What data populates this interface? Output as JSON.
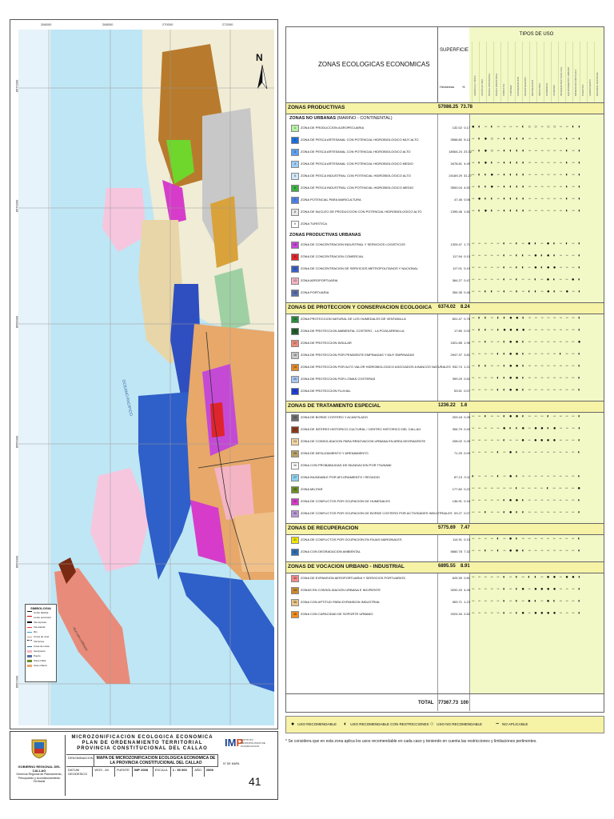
{
  "map": {
    "coords_top": [
      "266000",
      "268000",
      "270000",
      "272000"
    ],
    "coords_left": [
      "8672000",
      "8670000",
      "8668000",
      "8666000",
      "8664000",
      "8662000"
    ],
    "north_label": "N",
    "ocean_label": "OCEANO PACIFICO",
    "island_label": "ISLA SAN LORENZO",
    "legend": {
      "title": "SIMBOLOGIA",
      "items": [
        "Limite distrital",
        "Limite provincial",
        "Via expresa",
        "Via arterial",
        "Rio",
        "Curva de nivel",
        "Via ferrea",
        "Linea de costa",
        "Aeropuerto",
        "Puerto",
        "Zona militar",
        "Area urbana"
      ]
    }
  },
  "title_block": {
    "gov_logo_text": "GOBIERNO REGIONAL DEL CALLAO",
    "gov_sub": "Gerencia Regional de Planeamiento, Presupuesto y Acondicionamiento Territorial",
    "header_lines": [
      "MICROZONIFICACION ECOLOGICA ECONOMICA",
      "PLAN DE ORDENAMIENTO TERRITORIAL",
      "PROVINCIA CONSTITUCIONAL DEL CALLAO"
    ],
    "map_label": "DENOMINACION",
    "map_title": "MAPA DE MICROZONIFICACION ECOLOGICA ECONOMICA DE LA PROVINCIA CONSTITUCIONAL DEL CALLAO",
    "map_no_label": "N° DE MAPA",
    "map_no": "41",
    "row2": [
      "DATUM GEODESICO",
      "WGS - 84",
      "FUENTE",
      "IMP 2008",
      "ESCALA",
      "1 : 50 000",
      "AÑO",
      "2008"
    ],
    "imp_logo": "IMP",
    "imp_sub": "INSTITUTO METROPOLITANO DE PLANIFICACION"
  },
  "table": {
    "title": "ZONAS ECOLOGICAS ECONOMICAS",
    "superficie": "SUPERFICIE",
    "hectareas": "Hectareas",
    "percent": "%",
    "tipos_de_uso": "TIPOS DE USO",
    "use_columns": [
      "AGRICOLA TIPICA",
      "ACUICULTURA",
      "PESCA ARTESANAL",
      "PESCA INDUSTRIAL",
      "FORESTAL",
      "TURISMO",
      "CONSERVACION",
      "INVESTIGACION",
      "RECREACION",
      "INDUSTRIA",
      "COMERCIO",
      "VIVIENDA",
      "INFRAESTRUCTURA VIAL",
      "EQUIPAMIENTO URBANO",
      "MINERIA NO METALICA",
      "PUERTOS",
      "AEROPUERTO",
      "DEFENSA NACIONAL"
    ],
    "sections": [
      {
        "label": "ZONAS PRODUCTIVAS",
        "ha": "57086.25",
        "pct": "73.78",
        "subsections": [
          {
            "label": "ZONAS NO URBANAS",
            "sub": "(MARINO - CONTINENTAL)",
            "rows": [
              {
                "code": "1",
                "color": "#b6f0a4",
                "name": "ZONA DE PRODUCCION AGROPECUARIA",
                "ha": "132.02",
                "pct": "0.17",
                "uses": "● ◐ − ◐ − − − − ◐ ○ ○ − ○ ○ − − ◐ ◐"
              },
              {
                "code": "2",
                "color": "#1e6fd9",
                "name": "ZONA DE PESCA ARTESANAL CON POTENCIAL HIDROBIOLOGICO MUY ALTO",
                "ha": "3958.80",
                "pct": "5.12",
                "uses": "− ◐ ● ○ − ◐ ◐ ◐ ◐ − − − − − − ◐ − ◐"
              },
              {
                "code": "3",
                "color": "#5aa0f2",
                "name": "ZONA DE PESCA ARTESANAL CON POTENCIAL HIDROBIOLOGICO ALTO",
                "ha": "18064.24",
                "pct": "23.32",
                "uses": "− ◐ ● ○ − ◐ ◐ ◐ ◐ − − − − − − ◐ − ◐"
              },
              {
                "code": "4",
                "color": "#9fcdf7",
                "name": "ZONA DE PESCA ARTESANAL CON POTENCIAL HIDROBIOLOGICO MEDIO",
                "ha": "3478.81",
                "pct": "4.49",
                "uses": "− ◐ ● ◐ − ◐ ◐ ◐ ◐ − − − − − − ◐ − ◐"
              },
              {
                "code": "5",
                "color": "#cfe7fb",
                "name": "ZONA DE PESCA INDUSTRIAL CON POTENCIAL HIDROBIOLOGICO ALTO",
                "ha": "24169.29",
                "pct": "31.27",
                "uses": "− ◐ ◐ ● − ◐ ◐ ◐ ◐ − − − − − − ◐ − ◐"
              },
              {
                "code": "6",
                "color": "#3cb043",
                "name": "ZONA DE PESCA INDUSTRIAL CON POTENCIAL HIDROBIOLOGICO MEDIO",
                "ha": "3500.04",
                "pct": "4.53",
                "uses": "− ◐ ◐ ● − ◐ ◐ ◐ ◐ − − − − − − ◐ − ◐"
              },
              {
                "code": "7",
                "color": "#4d7fe0",
                "name": "ZONA POTENCIAL PARA MARICULTURA",
                "ha": "47.46",
                "pct": "0.06",
                "uses": "− ● ◐ ◐ − ◐ ◐ ◐ ◐ − − − − − − ◐ − ◐"
              },
              {
                "code": "8",
                "color": "#e6e6e6",
                "name": "ZONA DE NUCLEO DE PRODUCCION CON POTENCIAL HIDROBIOLOGICO ALTO",
                "ha": "1395.46",
                "pct": "1.81",
                "uses": "− ◐ ● ◐ − ◐ ◐ ◐ ◐ − − − − − − ◐ − ◐"
              },
              {
                "code": "9",
                "color": "#ffffff",
                "name": "ZONA TURISTICA",
                "ha": "",
                "pct": "",
                "uses": ""
              }
            ]
          },
          {
            "label": "ZONAS PRODUCTIVAS URBANAS",
            "sub": "",
            "rows": [
              {
                "code": "10",
                "color": "#c44ad6",
                "name": "ZONA DE CONCENTRACION INDUSTRIAL Y SERVICIOS LOGISTICOS",
                "ha": "1325.47",
                "pct": "1.71",
                "uses": "− − − − − ◐ − ◐ − ● ◐ − ● ◐ − ◐ − ◐"
              },
              {
                "code": "11",
                "color": "#e0242b",
                "name": "ZONA DE CONCENTRACION COMERCIAL",
                "ha": "117.94",
                "pct": "0.15",
                "uses": "− − − − − ◐ − ◐ ◐ − ● ◐ ● ◐ − − − ◐"
              },
              {
                "code": "12",
                "color": "#3a5fc4",
                "name": "ZONA DE CONCENTRACION DE SERVICIOS METROPOLITANOS Y NACIONAL",
                "ha": "117.01",
                "pct": "0.15",
                "uses": "− − − − − ◐ − ◐ ◐ − ● ◐ ● ● − − − ◐"
              },
              {
                "code": "13",
                "color": "#f4b4c4",
                "name": "ZONA AEROPORTUARIA",
                "ha": "364.27",
                "pct": "0.47",
                "uses": "− − − − − ◐ − ◐ − − ◐ − ● ◐ − − ● ◐"
              },
              {
                "code": "14",
                "color": "#5b6ea8",
                "name": "ZONA PORTUARIA",
                "ha": "354.35",
                "pct": "0.46",
                "uses": "− − ◐ ◐ − ◐ − ◐ − ◐ ◐ − ● ◐ − ● − ◐"
              }
            ]
          }
        ]
      },
      {
        "label": "ZONAS DE PROTECCION Y CONSERVACION ECOLOGICA",
        "ha": "6374.02",
        "pct": "8.24",
        "subsections": [
          {
            "label": "",
            "sub": "",
            "rows": [
              {
                "code": "15",
                "color": "#2e8b3e",
                "name": "ZONA PROTECCION NATURAL DE LOS HUMEDALES DE VENTANILLA",
                "ha": "601.47",
                "pct": "0.78",
                "uses": "− ◐ ◐ − ◐ ◐ ● ● ◐ − − − − − − − − ◐"
              },
              {
                "code": "16",
                "color": "#1f5e2a",
                "name": "ZONA DE PROTECCION AMBIENTAL COSTERO - LA POZA ARENILLA",
                "ha": "17.80",
                "pct": "0.02",
                "uses": "− ◐ ◐ − ◐ ● ● ● ● − − − − − − − − ◐"
              },
              {
                "code": "17",
                "color": "#e98b7a",
                "name": "ZONA DE PROTECCION INSULAR",
                "ha": "1521.85",
                "pct": "1.96",
                "uses": "− − ◐ − − ◐ ● ● ◐ − − − − − − − − ●"
              },
              {
                "code": "18",
                "color": "#c9c9c9",
                "name": "ZONA DE PROTECCION POR PENDIENTE EMPINADAS Y MUY EMPINADAS",
                "ha": "2947.37",
                "pct": "3.81",
                "uses": "− − − − ◐ ◐ ● ● ◐ − − − − − ◐ − − ◐"
              },
              {
                "code": "19",
                "color": "#e28a2a",
                "name": "ZONA DE PROTECCION POR ALTO VALOR HIDROBIOLOGICO ASOCIADOS A BANCOS NATURALES",
                "ha": "932.74",
                "pct": "1.21",
                "uses": "− ◐ ◐ − − ◐ ● ● ◐ − − − − − − − − ◐"
              },
              {
                "code": "20",
                "color": "#a7c8f4",
                "name": "ZONA DE PROTECCION POR LOMAS COSTERAS",
                "ha": "399.29",
                "pct": "0.52",
                "uses": "− − − − ◐ ◐ ● ● ◐ − − − − − − − − ◐"
              },
              {
                "code": "21",
                "color": "#1e3fd0",
                "name": "ZONA DE PROTECCION FLUVIAL",
                "ha": "53.51",
                "pct": "0.07",
                "uses": "− − − − ◐ ◐ ● ● ◐ − − − − − − − − ◐"
              }
            ]
          }
        ]
      },
      {
        "label": "ZONAS DE TRATAMIENTO ESPECIAL",
        "ha": "1236.22",
        "pct": "1.6",
        "subsections": [
          {
            "label": "",
            "sub": "",
            "rows": [
              {
                "code": "22",
                "color": "#6d6d6d",
                "name": "ZONA DE BORDE COSTERO Y ACANTILADO",
                "ha": "203.18",
                "pct": "0.26",
                "uses": "− − ◐ − − ◐ ● ● ◐ − − − ◐ − − − − ◐"
              },
              {
                "code": "23",
                "color": "#8a3b1a",
                "name": "ZONA DE INTERES HISTORICO-CULTURAL / CENTRO HISTORICO DEL CALLAO",
                "ha": "306.79",
                "pct": "0.40",
                "uses": "− − − − − ● ◐ ◐ ● − ● ● ◐ ● − − − ◐"
              },
              {
                "code": "24",
                "color": "#f5d5a3",
                "name": "ZONA DE CONSOLIDACION PARA RENOVACION URBANA EN AREA DEGRADENTE",
                "ha": "208.02",
                "pct": "0.26",
                "uses": "− − − − − ◐ − − ● − ● ● ● ● − − − ◐"
              },
              {
                "code": "25",
                "color": "#b8a26a",
                "name": "ZONA DE DESLIZAMIENTO Y ARENAMIENTO",
                "ha": "71.29",
                "pct": "0.09",
                "uses": "− − − − ◐ − ● ◐ − − − − − − − − − ◐"
              },
              {
                "code": "26",
                "color": "#ffffff",
                "name": "ZONA CON PROBABILIDAD DE INUNDACION POR TSUNAMI",
                "ha": "",
                "pct": "",
                "uses": ""
              },
              {
                "code": "27",
                "color": "#8fd3f0",
                "name": "ZONA INUNDABLE POR AFLORAMIENTO / REGADIO",
                "ha": "87.13",
                "pct": "0.11",
                "uses": "◐ − − − ◐ − ● ◐ − − − − − − − − − ◐"
              },
              {
                "code": "28",
                "color": "#6b8e23",
                "name": "ZONA MILITAR",
                "ha": "177.82",
                "pct": "0.23",
                "uses": "− − − − − − − ◐ − − − − ◐ − − − − ●"
              },
              {
                "code": "29",
                "color": "#d63cc9",
                "name": "ZONA DE CONFLICTOS POR OCUPACION DE HUMEDALES",
                "ha": "136.91",
                "pct": "0.18",
                "uses": "− − − − − ◐ ● ● ◐ − − − − − − − − ◐"
              },
              {
                "code": "30",
                "color": "#b99bd6",
                "name": "ZONA DE CONFLICTOS POR OCUPACION DE BORDE COSTERO POR ACTIVIDADES INDUSTRIALES",
                "ha": "53.27",
                "pct": "0.07",
                "uses": "− − ◐ − − ◐ ● ◐ ◐ − − − − − − − − ◐"
              }
            ]
          }
        ]
      },
      {
        "label": "ZONAS DE RECUPERACION",
        "ha": "5775.69",
        "pct": "7.47",
        "subsections": [
          {
            "label": "",
            "sub": "",
            "rows": [
              {
                "code": "31",
                "color": "#f2e600",
                "name": "ZONA DE CONFLICTOS POR OCUPACION EN FAJAS MARGINALES",
                "ha": "114.91",
                "pct": "0.15",
                "uses": "− − − − ◐ − ● ◐ − − − − − − − − − ◐"
              },
              {
                "code": "32",
                "color": "#2f6db5",
                "name": "ZONA CON DEGRADACION AMBIENTAL",
                "ha": "5660.78",
                "pct": "7.32",
                "uses": "− − ◐ − ◐ − ● ● ◐ − − − − − − − − ◐"
              }
            ]
          }
        ]
      },
      {
        "label": "ZONAS DE VOCACION URBANO - INDUSTRIAL",
        "ha": "6895.55",
        "pct": "8.91",
        "subsections": [
          {
            "label": "",
            "sub": "",
            "rows": [
              {
                "code": "33",
                "color": "#f58a8a",
                "name": "ZONA DE EXPANSION AEROPORTUARIA Y SERVICIOS PORTUARIOS",
                "ha": "625.30",
                "pct": "0.81",
                "uses": "− − − − − ◐ − ◐ − ◐ ◐ − ● ● − ● ● ◐"
              },
              {
                "code": "34",
                "color": "#c98a2f",
                "name": "ZONAS EN CONSOLIDACION URBANA E INCIPIENTE",
                "ha": "3292.20",
                "pct": "4.26",
                "uses": "− − − − − ◐ − ◐ ● − ● ● ● ● − − − ◐"
              },
              {
                "code": "35",
                "color": "#e8c48a",
                "name": "ZONA CON APTITUD PARA EXPANSION INDUSTRIAL",
                "ha": "953.71",
                "pct": "1.23",
                "uses": "− − − − − ◐ − ◐ − ● ◐ − ● ◐ − − − ◐"
              },
              {
                "code": "36",
                "color": "#f28c1e",
                "name": "ZONA CON CAPACIDAD DE SOPORTE URBANO",
                "ha": "2024.34",
                "pct": "2.62",
                "uses": "− − − − − ◐ − ◐ ● − ● ● ● ● − − − ◐"
              }
            ]
          }
        ]
      }
    ],
    "total_label": "TOTAL",
    "total_ha": "77367.73",
    "total_pct": "100"
  },
  "use_legend": [
    {
      "symbol": "●",
      "label": "USO RECOMENDABLE"
    },
    {
      "symbol": "◐",
      "label": "USO RECOMENDABLE CON RESTRICCIONES"
    },
    {
      "symbol": "○",
      "label": "USO NO RECOMENDABLE"
    },
    {
      "symbol": "−",
      "label": "NO APLICABLE"
    }
  ],
  "footnote": "* Se considera que en esta zona aplica los usos recomendable en cada caso y teniendo en cuenta las restricciones y limitaciones pertinentes."
}
